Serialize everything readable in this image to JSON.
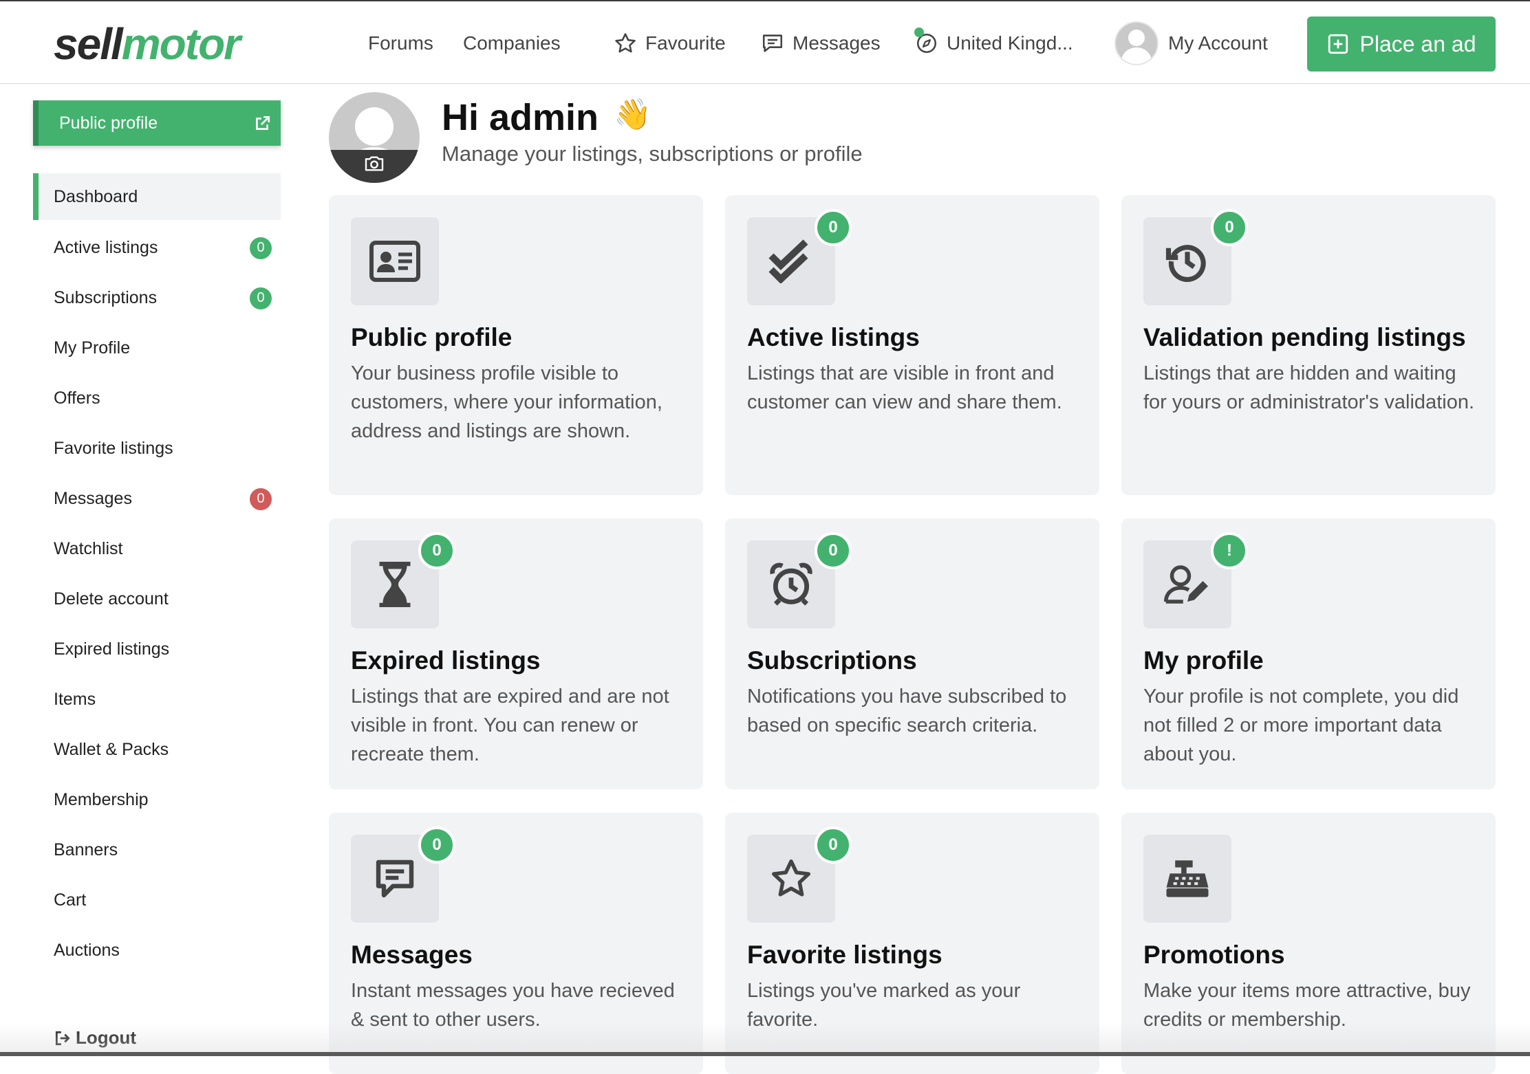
{
  "header": {
    "logo_part1": "sell",
    "logo_part2": "motor",
    "nav": {
      "forums": "Forums",
      "companies": "Companies",
      "favourite": "Favourite",
      "messages": "Messages",
      "location": "United Kingd...",
      "account": "My Account"
    },
    "place_ad": "Place an ad"
  },
  "sidebar": {
    "public_profile": "Public profile",
    "items": [
      {
        "label": "Dashboard"
      },
      {
        "label": "Active listings",
        "badge": "0"
      },
      {
        "label": "Subscriptions",
        "badge": "0"
      },
      {
        "label": "My Profile"
      },
      {
        "label": "Offers"
      },
      {
        "label": "Favorite listings"
      },
      {
        "label": "Messages",
        "badge": "0"
      },
      {
        "label": "Watchlist"
      },
      {
        "label": "Delete account"
      },
      {
        "label": "Expired listings"
      },
      {
        "label": "Items"
      },
      {
        "label": "Wallet & Packs"
      },
      {
        "label": "Membership"
      },
      {
        "label": "Banners"
      },
      {
        "label": "Cart"
      },
      {
        "label": "Auctions"
      }
    ],
    "logout": "Logout"
  },
  "welcome": {
    "greeting": "Hi admin",
    "wave": "👋",
    "subtitle": "Manage your listings, subscriptions or profile"
  },
  "cards": [
    {
      "title": "Public profile",
      "desc": "Your business profile visible to customers, where your information, address and listings are shown.",
      "icon": "id-card-icon"
    },
    {
      "title": "Active listings",
      "desc": "Listings that are visible in front and customer can view and share them.",
      "badge": "0",
      "icon": "double-check-icon"
    },
    {
      "title": "Validation pending listings",
      "desc": "Listings that are hidden and waiting for yours or administrator's validation.",
      "badge": "0",
      "icon": "history-icon"
    },
    {
      "title": "Expired listings",
      "desc": "Listings that are expired and are not visible in front. You can renew or recreate them.",
      "badge": "0",
      "icon": "hourglass-icon"
    },
    {
      "title": "Subscriptions",
      "desc": "Notifications you have subscribed to based on specific search criteria.",
      "badge": "0",
      "icon": "alarm-clock-icon"
    },
    {
      "title": "My profile",
      "desc": "Your profile is not complete, you did not filled 2 or more important data about you.",
      "badge": "!",
      "icon": "user-edit-icon"
    },
    {
      "title": "Messages",
      "desc": "Instant messages you have recieved & sent to other users.",
      "badge": "0",
      "icon": "message-icon"
    },
    {
      "title": "Favorite listings",
      "desc": "Listings you've marked as your favorite.",
      "badge": "0",
      "icon": "star-icon"
    },
    {
      "title": "Promotions",
      "desc": "Make your items more attractive, buy credits or membership.",
      "icon": "cash-register-icon"
    }
  ],
  "colors": {
    "accent": "#43b26e",
    "danger": "#d15a5a"
  }
}
